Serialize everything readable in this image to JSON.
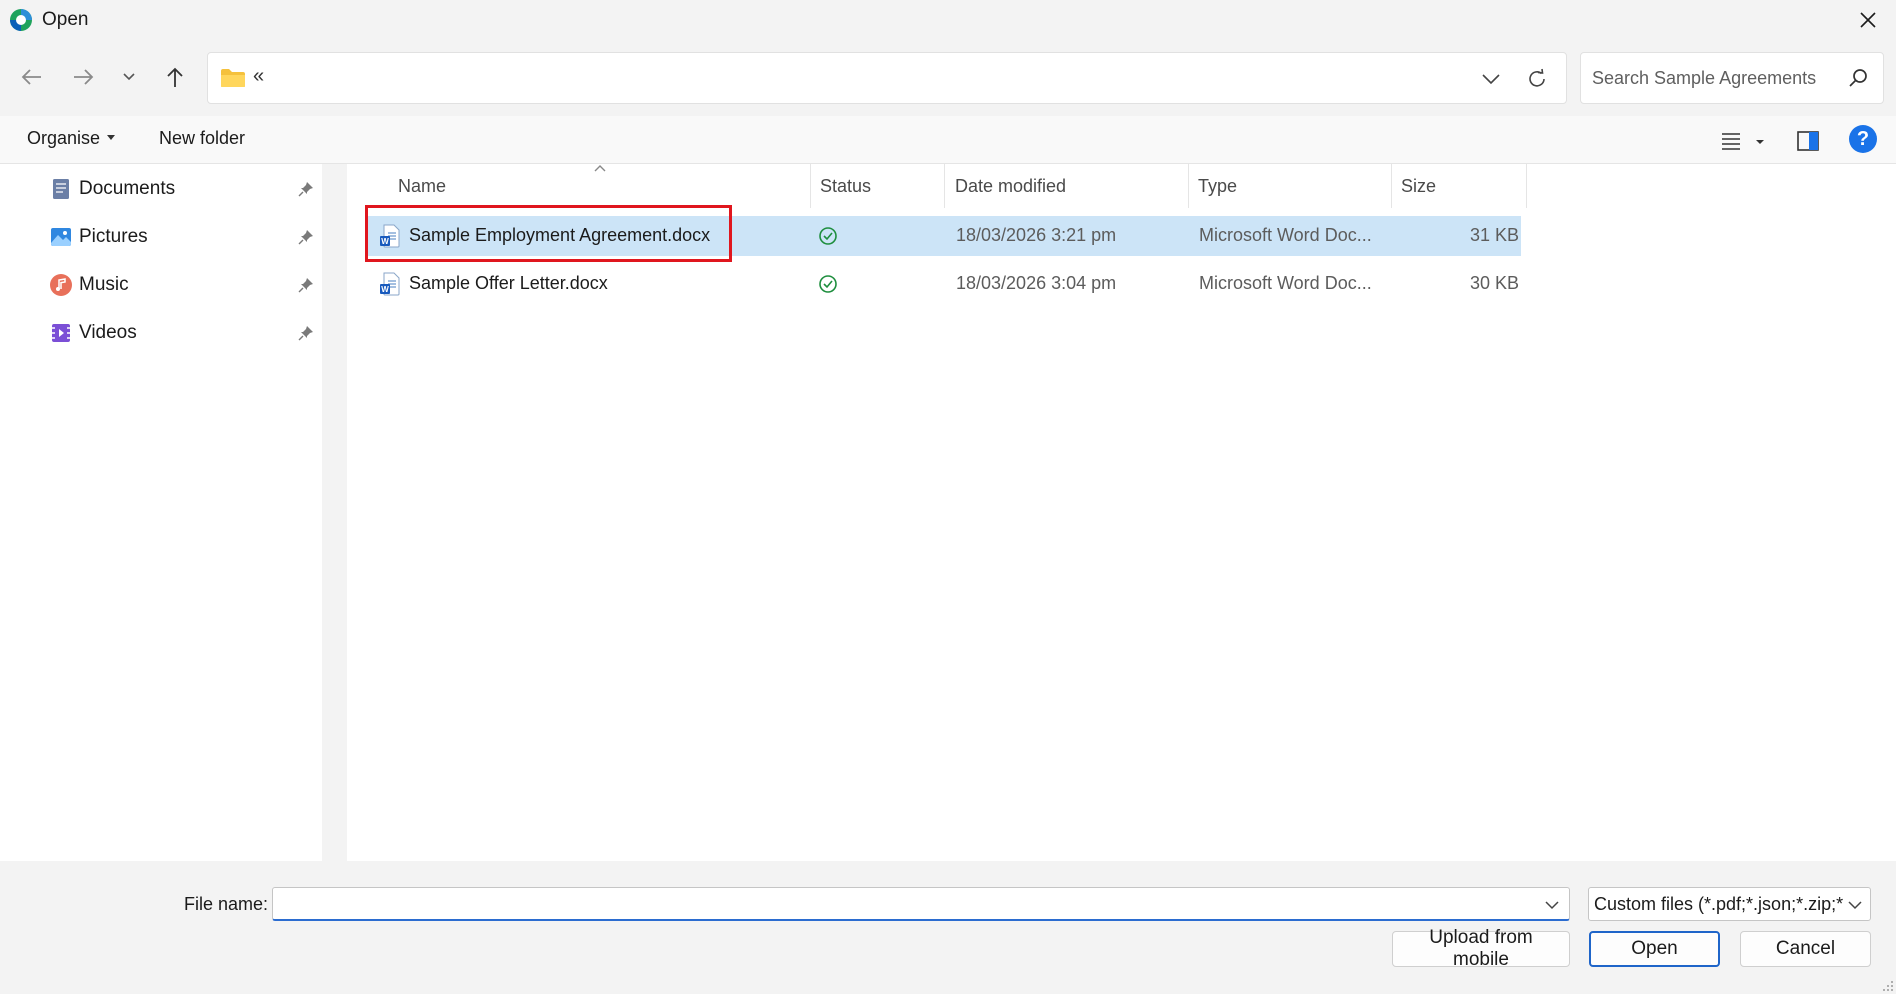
{
  "window": {
    "title": "Open"
  },
  "address_bar": {
    "overflow_chevron": "«"
  },
  "search": {
    "placeholder": "Search Sample Agreements"
  },
  "toolbar": {
    "organise_label": "Organise",
    "new_folder_label": "New folder",
    "help_label": "?"
  },
  "sidebar": {
    "items": [
      {
        "label": "Documents",
        "icon": "documents-icon"
      },
      {
        "label": "Pictures",
        "icon": "pictures-icon"
      },
      {
        "label": "Music",
        "icon": "music-icon"
      },
      {
        "label": "Videos",
        "icon": "videos-icon"
      }
    ]
  },
  "file_list": {
    "columns": [
      "Name",
      "Status",
      "Date modified",
      "Type",
      "Size"
    ],
    "sort_column": "Name",
    "rows": [
      {
        "name": "Sample Employment Agreement.docx",
        "status": "synced",
        "date_modified": "18/03/2026 3:21 pm",
        "type": "Microsoft Word Doc...",
        "size": "31 KB",
        "selected": true
      },
      {
        "name": "Sample Offer Letter.docx",
        "status": "synced",
        "date_modified": "18/03/2026 3:04 pm",
        "type": "Microsoft Word Doc...",
        "size": "30 KB",
        "selected": false
      }
    ]
  },
  "footer": {
    "file_name_label": "File name:",
    "file_name_value": "",
    "file_type_filter": "Custom files (*.pdf;*.json;*.zip;*",
    "upload_button": "Upload from mobile",
    "open_button": "Open",
    "cancel_button": "Cancel"
  },
  "colors": {
    "accent": "#1f65c9",
    "selection": "#cce4f7",
    "highlight_box": "#e0161e",
    "status_ok": "#1e8e3e"
  }
}
